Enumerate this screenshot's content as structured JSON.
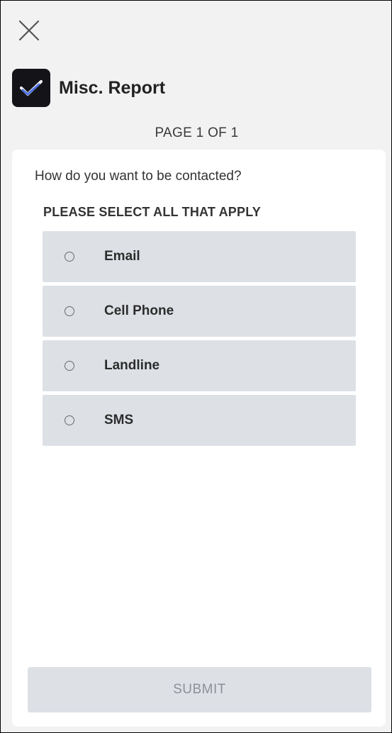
{
  "header": {
    "app_icon": "checkmark-logo-icon",
    "title": "Misc. Report",
    "close_icon": "close-icon"
  },
  "page_indicator": "PAGE 1 OF 1",
  "form": {
    "question": "How do you want to be contacted?",
    "instruction": "PLEASE SELECT ALL THAT APPLY",
    "options": [
      {
        "label": "Email",
        "checked": false
      },
      {
        "label": "Cell Phone",
        "checked": false
      },
      {
        "label": "Landline",
        "checked": false
      },
      {
        "label": "SMS",
        "checked": false
      }
    ],
    "submit_label": "SUBMIT",
    "submit_enabled": false
  },
  "colors": {
    "background": "#f2f2f3",
    "card": "#ffffff",
    "option_bg": "#dde1e6",
    "text": "#333333",
    "logo_bg": "#141418",
    "logo_accent": "#4d6fe0"
  }
}
